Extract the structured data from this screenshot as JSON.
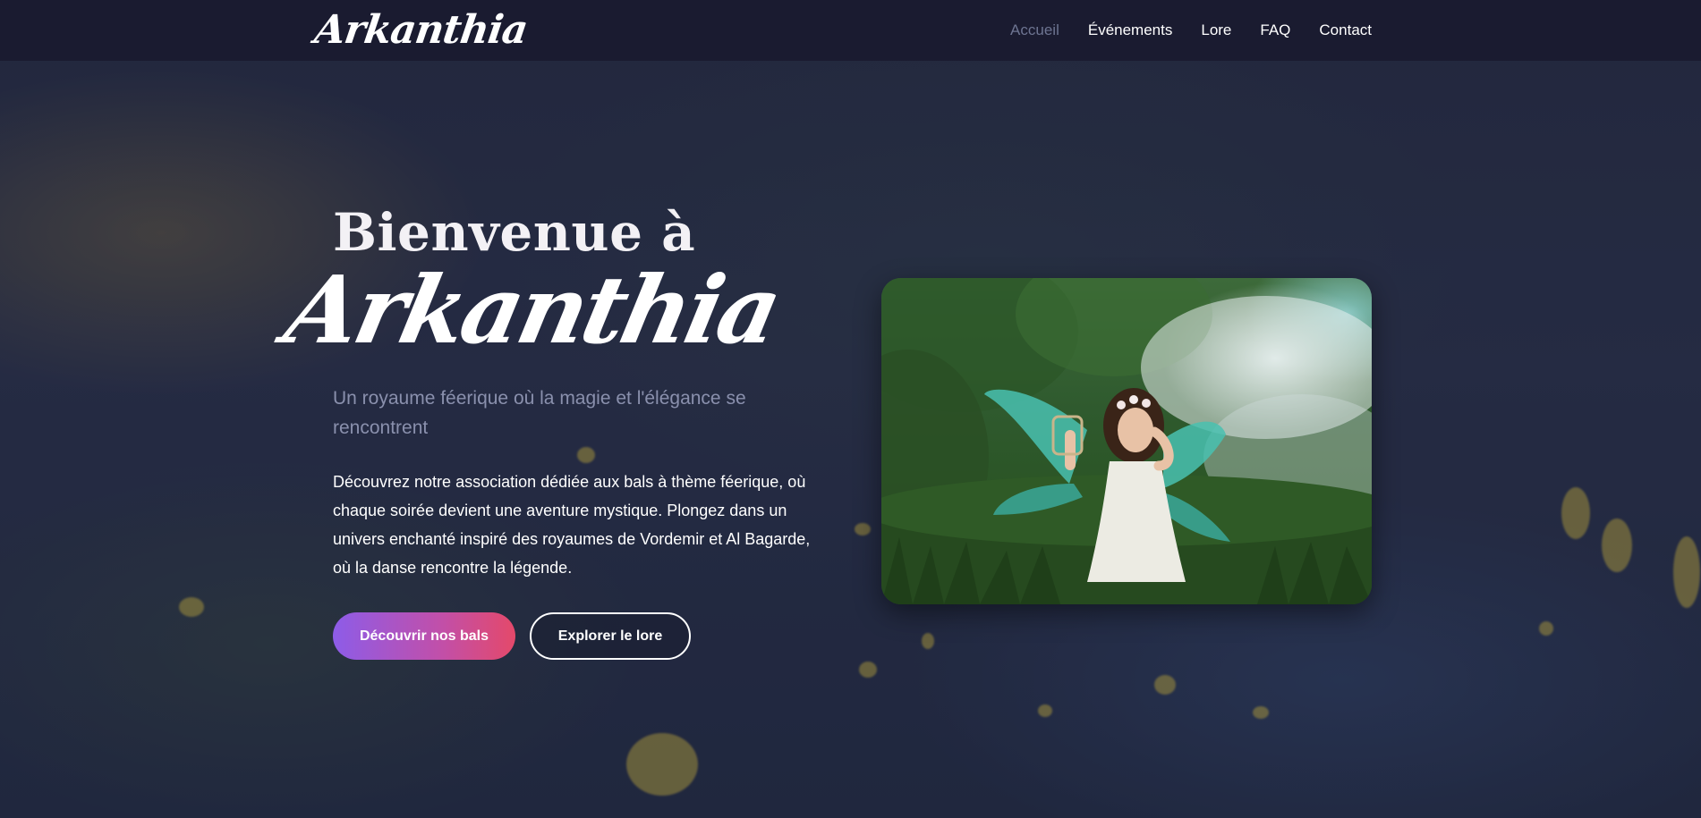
{
  "nav": {
    "logo": "Arkanthia",
    "links": [
      {
        "label": "Accueil",
        "active": true
      },
      {
        "label": "Événements",
        "active": false
      },
      {
        "label": "Lore",
        "active": false
      },
      {
        "label": "FAQ",
        "active": false
      },
      {
        "label": "Contact",
        "active": false
      }
    ]
  },
  "hero": {
    "heading": "Bienvenue à",
    "brand": "Arkanthia",
    "subtitle": "Un royaume féerique où la magie et l'élégance se rencontrent",
    "description": "Découvrez notre association dédiée aux bals à thème féerique, où chaque soirée devient une aventure mystique. Plongez dans un univers enchanté inspiré des royaumes de Vordemir et Al Bagarde, où la danse rencontre la légende.",
    "primary_button": "Découvrir nos bals",
    "secondary_button": "Explorer le lore"
  },
  "colors": {
    "nav_bg": "#1a1b30",
    "accent_start": "#8d5ce8",
    "accent_end": "#e4496a",
    "muted_text": "#8a90ad"
  }
}
